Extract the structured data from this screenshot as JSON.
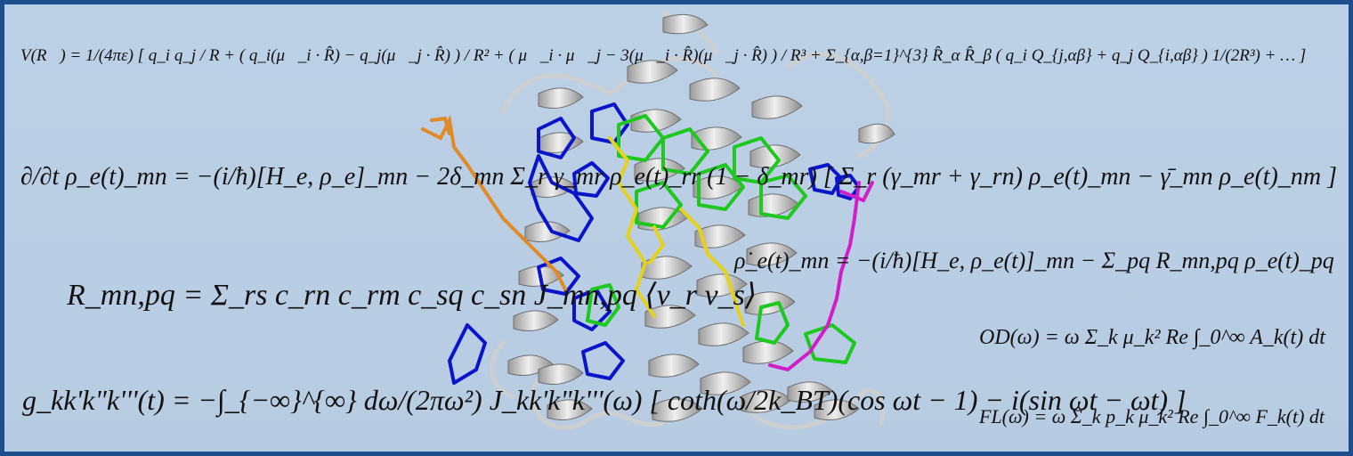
{
  "equations": {
    "multipole_potential": "V(R⃗) = 1/(4πε) [ q_i q_j / R + ( q_i(μ⃗_i · R̂) − q_j(μ⃗_j · R̂) ) / R² + ( μ⃗_i · μ⃗_j − 3(μ⃗_i · R̂)(μ⃗_j · R̂) ) / R³ + Σ_{α,β=1}^{3} R̂_α R̂_β ( q_i Q_{j,αβ} + q_j Q_{i,αβ} ) 1/(2R³) + … ]",
    "density_matrix_eom": "∂/∂t ρ_e(t)_mn = −(i/ħ)[H_e, ρ_e]_mn − 2δ_mn Σ_r γ_mr ρ_e(t)_rr (1 − δ_mr) [ Σ_r (γ_mr + γ_rn) ρ_e(t)_mn − γ̄_mn ρ_e(t)_nm ]",
    "redfield_tensor": "R_mn,pq = Σ_rs c_rn c_rm c_sq c_sn J_mn,pq ⟨v_r v_s⟩",
    "redfield_equation": "ρ̇_e(t)_mn = −(i/ħ)[H_e, ρ_e(t)]_mn − Σ_pq R_mn,pq ρ_e(t)_pq",
    "lineshape_function": "g_kk'k\"k'''(t) = −∫_{−∞}^{∞} dω/(2πω²) J_kk'k\"k'''(ω) [ coth(ω/2k_BT)(cos ωt − 1) − i(sin ωt − ωt) ]",
    "absorption": "OD(ω) = ω Σ_k μ_k² Re ∫_0^∞ A_k(t) dt",
    "fluorescence": "FL(ω) = ω Σ_k p_k μ_k² Re ∫_0^∞ F_k(t) dt"
  },
  "colors": {
    "background": "#b9cde3",
    "border": "#1f4e8c",
    "helix": "#d6d6d6",
    "pigment_blue": "#0a14c8",
    "pigment_green": "#1ec81e",
    "pigment_yellow": "#e6d21e",
    "pigment_orange": "#e08a28",
    "pigment_magenta": "#d21ec8"
  }
}
